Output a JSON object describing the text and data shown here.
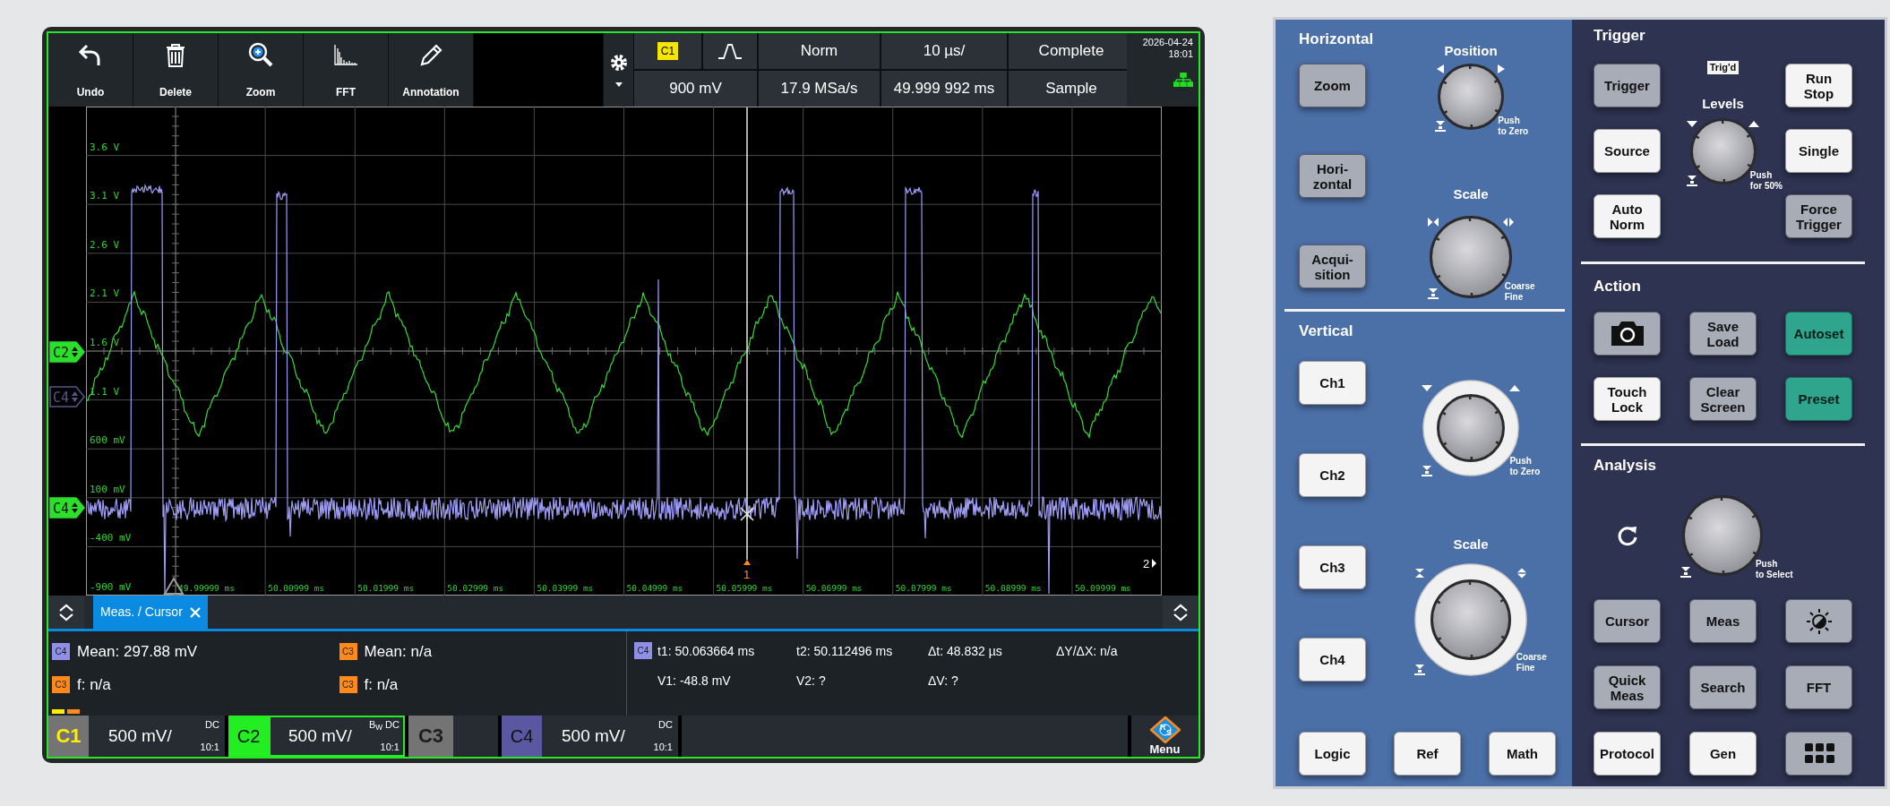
{
  "toolbar": {
    "buttons": [
      {
        "label": "Undo"
      },
      {
        "label": "Delete"
      },
      {
        "label": "Zoom"
      },
      {
        "label": "FFT"
      },
      {
        "label": "Annotation"
      }
    ]
  },
  "status": {
    "source": "C1",
    "trigger_level": "900 mV",
    "trigger_mode": "Norm",
    "sample_rate": "17.9 MSa/s",
    "time_scale": "10 µs/",
    "position": "49.999 992 ms",
    "acquisition_state": "Complete",
    "acquisition_mode": "Sample",
    "date": "2026-04-24",
    "time": "18:01"
  },
  "plot": {
    "y_labels": [
      "3.6 V",
      "3.1 V",
      "2.6 V",
      "2.1 V",
      "1.6 V",
      "1.1 V",
      "600 mV",
      "100 mV",
      "-400 mV",
      "-900 mV"
    ],
    "x_labels": [
      "49.99999 ms",
      "50.00999 ms",
      "50.01999 ms",
      "50.02999 ms",
      "50.03999 ms",
      "50.04999 ms",
      "50.05999 ms",
      "50.06999 ms",
      "50.07999 ms",
      "50.08999 ms",
      "50.09999 ms"
    ],
    "markers": [
      {
        "label": "C2",
        "color": "#2be02b",
        "filled": true
      },
      {
        "label": "C4",
        "color": "#56568a",
        "filled": false
      },
      {
        "label": "C4",
        "color": "#2be02b",
        "filled": true
      }
    ],
    "traces": [
      {
        "kind": "triangle",
        "color": "#33dd33"
      },
      {
        "kind": "pulse",
        "color": "#9d9cf5"
      }
    ],
    "cursors": [
      {
        "label": "1"
      },
      {
        "label": "2"
      }
    ]
  },
  "tabs": [
    {
      "label": "Meas. / Cursor",
      "selected": true
    }
  ],
  "measurements": [
    {
      "channel": "C4",
      "color": "#8f8fe8",
      "text": "Mean: 297.88 mV"
    },
    {
      "channel": "C3",
      "color": "#ff8a1c",
      "text": "Mean: n/a"
    },
    {
      "channel": "C3",
      "color": "#ff8a1c",
      "text": "f: n/a"
    },
    {
      "channel": "C3",
      "color": "#ff8a1c",
      "text": "f: n/a"
    }
  ],
  "indicators": [
    {
      "color": "#ffee00"
    },
    {
      "color": "#ff8a1c"
    }
  ],
  "cursor_readout": {
    "channel": "C4",
    "color": "#8f8fe8",
    "rows": [
      [
        "t1: 50.063664 ms",
        "t2: 50.112496 ms",
        "Δt: 48.832 µs",
        "ΔY/ΔX: n/a"
      ],
      [
        "V1: -48.8 mV",
        "V2: ?",
        "ΔV: ?"
      ]
    ]
  },
  "channels": [
    {
      "label": "C1",
      "color": "#ffee00",
      "filled": false,
      "selected": false,
      "scale": "500 mV/",
      "coupling": "DC",
      "probe": "10:1"
    },
    {
      "label": "C2",
      "color": "#22ee22",
      "filled": true,
      "selected": true,
      "scale": "500 mV/",
      "coupling": "B$_{W}$ DC",
      "probe": "10:1"
    },
    {
      "label": "C3",
      "selected": false
    },
    {
      "label": "C4",
      "color": "#5a58a0",
      "filled": true,
      "selected": false,
      "scale": "500 mV/",
      "coupling": "DC",
      "probe": "10:1"
    }
  ],
  "menu": {
    "logo_letters": [
      "R",
      "S"
    ],
    "label": "Menu"
  },
  "panel": {
    "horizontal": {
      "title": "Horizontal",
      "buttons": [
        {
          "label": "Zoom",
          "kind": "normal"
        },
        {
          "label": "Hori-\nzontal",
          "kind": "normal"
        },
        {
          "label": "Acqui-\nsition",
          "kind": "normal"
        }
      ],
      "knobs": [
        {
          "kind": "plain",
          "title": "Position",
          "hint": "Push\nto Zero"
        },
        {
          "kind": "plain",
          "title": "Scale",
          "hint": "Coarse\nFine"
        }
      ]
    },
    "vertical": {
      "title": "Vertical",
      "buttons": [
        {
          "label": "Ch1",
          "kind": "lit"
        },
        {
          "label": "Ch2",
          "kind": "lit"
        },
        {
          "label": "Ch3",
          "kind": "lit"
        },
        {
          "label": "Ch4",
          "kind": "lit"
        }
      ],
      "knobs": [
        {
          "kind": "ringed",
          "hint": "Push\nto Zero"
        },
        {
          "kind": "ringed",
          "title": "Scale",
          "hint": "Coarse\nFine"
        }
      ],
      "bottom_buttons": [
        {
          "label": "Logic",
          "kind": "lit"
        },
        {
          "label": "Ref",
          "kind": "lit"
        },
        {
          "label": "Math",
          "kind": "lit"
        }
      ]
    },
    "trigger": {
      "title": "Trigger",
      "state": "Trig'd",
      "buttons_left": [
        {
          "label": "Trigger",
          "kind": "normal"
        },
        {
          "label": "Source",
          "kind": "lit"
        },
        {
          "label": "Auto\nNorm",
          "kind": "lit"
        }
      ],
      "buttons_right": [
        {
          "label": "Run\nStop",
          "kind": "lit"
        },
        {
          "label": "Single",
          "kind": "lit"
        },
        {
          "label": "Force\nTrigger",
          "kind": "normal"
        }
      ],
      "knob": {
        "kind": "plain",
        "title": "Levels",
        "hint": "Push\nfor 50%"
      }
    },
    "action": {
      "title": "Action",
      "buttons": [
        {
          "kind": "normal"
        },
        {
          "label": "Save\nLoad",
          "kind": "normal"
        },
        {
          "label": "Autoset",
          "kind": "accent"
        },
        {
          "label": "Touch\nLock",
          "kind": "lit"
        },
        {
          "label": "Clear\nScreen",
          "kind": "normal"
        },
        {
          "label": "Preset",
          "kind": "accent"
        }
      ]
    },
    "analysis": {
      "title": "Analysis",
      "knob": {
        "kind": "plain",
        "hint": "Push\nto Select"
      },
      "buttons": [
        {
          "label": "Cursor",
          "kind": "normal"
        },
        {
          "label": "Meas",
          "kind": "normal"
        },
        {
          "kind": "normal"
        },
        {
          "label": "Quick\nMeas",
          "kind": "normal"
        },
        {
          "label": "Search",
          "kind": "normal"
        },
        {
          "label": "FFT",
          "kind": "normal"
        },
        {
          "label": "Protocol",
          "kind": "lit"
        },
        {
          "label": "Gen",
          "kind": "lit"
        },
        {
          "kind": "normal"
        }
      ]
    }
  }
}
